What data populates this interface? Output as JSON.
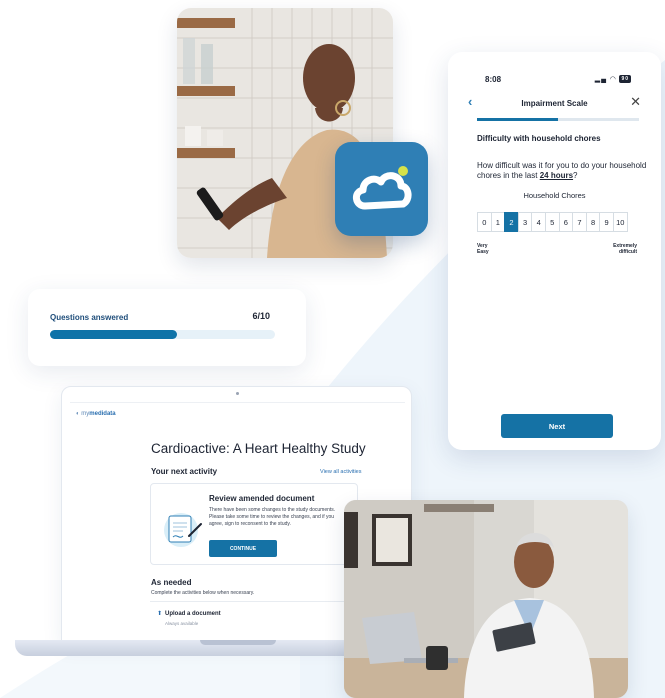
{
  "progress_card": {
    "label": "Questions answered",
    "count": "6/10",
    "progress": 0.6
  },
  "phone": {
    "status_time": "8:08",
    "status_battery": "90",
    "title": "Impairment Scale",
    "back_icon": "chevron-left-icon",
    "close_icon": "close-icon",
    "progress": 0.5,
    "heading": "Difficulty with household chores",
    "question_pre": "How difficult was it for you to do your household chores in the last ",
    "question_em": "24 hours",
    "question_post": "?",
    "sublabel": "Household Chores",
    "scale": [
      "0",
      "1",
      "2",
      "3",
      "4",
      "5",
      "6",
      "7",
      "8",
      "9",
      "10"
    ],
    "selected": "2",
    "anchor_left_line1": "Very",
    "anchor_left_line2": "Easy",
    "anchor_right_line1": "Extremely",
    "anchor_right_line2": "difficult",
    "next_label": "Next"
  },
  "laptop": {
    "brand_prefix": "my",
    "brand_name": "medidata",
    "study_title": "Cardioactive: A Heart Healthy Study",
    "next_activity": "Your next activity",
    "view_all": "View all activities",
    "activity": {
      "title": "Review amended document",
      "description": "There have been some changes to the study documents. Please take some time to review the changes, and if you agree, sign to reconsent to the study.",
      "button": "CONTINUE"
    },
    "as_needed": "As needed",
    "as_needed_sub": "Complete the activities below when necessary.",
    "upload": {
      "title": "Upload a document",
      "subtitle": "Always available"
    }
  },
  "colors": {
    "brand_blue": "#1572a5",
    "logo_blue": "#2f7fb5",
    "logo_dot": "#d6e24a"
  },
  "icons": {
    "logo": "cloud-icon",
    "upload": "upload-icon"
  }
}
